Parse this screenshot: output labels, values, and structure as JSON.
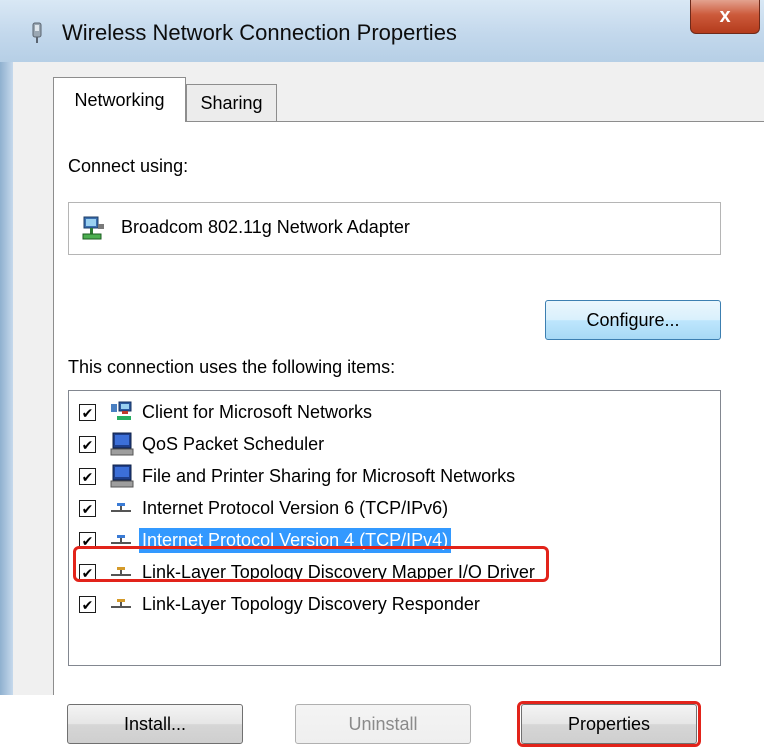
{
  "window": {
    "title": "Wireless Network Connection Properties",
    "close_symbol": "x"
  },
  "tabs": [
    {
      "label": "Networking",
      "active": true
    },
    {
      "label": "Sharing",
      "active": false
    }
  ],
  "connect_using": {
    "label": "Connect using:",
    "adapter_name": "Broadcom 802.11g Network Adapter",
    "adapter_icon": "network-adapter-icon",
    "configure_label": "Configure..."
  },
  "items_section": {
    "label": "This connection uses the following items:",
    "items": [
      {
        "label": "Client for Microsoft Networks",
        "checked": true,
        "icon": "client-network-icon",
        "selected": false
      },
      {
        "label": "QoS Packet Scheduler",
        "checked": true,
        "icon": "computer-icon",
        "selected": false
      },
      {
        "label": "File and Printer Sharing for Microsoft Networks",
        "checked": true,
        "icon": "computer-icon",
        "selected": false
      },
      {
        "label": "Internet Protocol Version 6 (TCP/IPv6)",
        "checked": true,
        "icon": "protocol-icon",
        "selected": false
      },
      {
        "label": "Internet Protocol Version 4 (TCP/IPv4)",
        "checked": true,
        "icon": "protocol-icon",
        "selected": true
      },
      {
        "label": "Link-Layer Topology Discovery Mapper I/O Driver",
        "checked": true,
        "icon": "protocol-icon",
        "selected": false
      },
      {
        "label": "Link-Layer Topology Discovery Responder",
        "checked": true,
        "icon": "protocol-icon",
        "selected": false
      }
    ]
  },
  "buttons": {
    "install": "Install...",
    "uninstall": "Uninstall",
    "properties": "Properties"
  },
  "colors": {
    "selection": "#3399ff",
    "highlight_outline": "#e2231a"
  }
}
